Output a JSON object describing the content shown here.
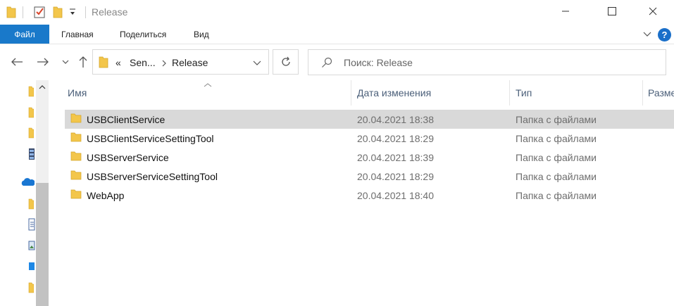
{
  "title_bar": {
    "title": "Release",
    "colors": {
      "folder": "#f3c64b",
      "check_red": "#d9452b"
    }
  },
  "ribbon": {
    "file_tab": "Файл",
    "tabs": [
      "Главная",
      "Поделиться",
      "Вид"
    ],
    "help_label": "?",
    "colors": {
      "file_tab_bg": "#1979ca"
    }
  },
  "navigation": {
    "breadcrumb_overflow": "«",
    "breadcrumbs": [
      "Sen...",
      "Release"
    ],
    "search_placeholder": "Поиск: Release"
  },
  "nav_pane": {
    "icons": [
      "folder-icon",
      "folder-icon",
      "folder-icon",
      "app-icon",
      "onedrive-icon",
      "folder-icon",
      "document-icon",
      "image-icon",
      "desktop-icon",
      "folder-icon"
    ]
  },
  "file_list": {
    "columns": [
      "Имя",
      "Дата изменения",
      "Тип",
      "Разме"
    ],
    "sorted_column": "Имя",
    "rows": [
      {
        "name": "USBClientService",
        "date": "20.04.2021 18:38",
        "type": "Папка с файлами",
        "selected": true
      },
      {
        "name": "USBClientServiceSettingTool",
        "date": "20.04.2021 18:29",
        "type": "Папка с файлами",
        "selected": false
      },
      {
        "name": "USBServerService",
        "date": "20.04.2021 18:39",
        "type": "Папка с файлами",
        "selected": false
      },
      {
        "name": "USBServerServiceSettingTool",
        "date": "20.04.2021 18:29",
        "type": "Папка с файлами",
        "selected": false
      },
      {
        "name": "WebApp",
        "date": "20.04.2021 18:40",
        "type": "Папка с файлами",
        "selected": false
      }
    ]
  }
}
